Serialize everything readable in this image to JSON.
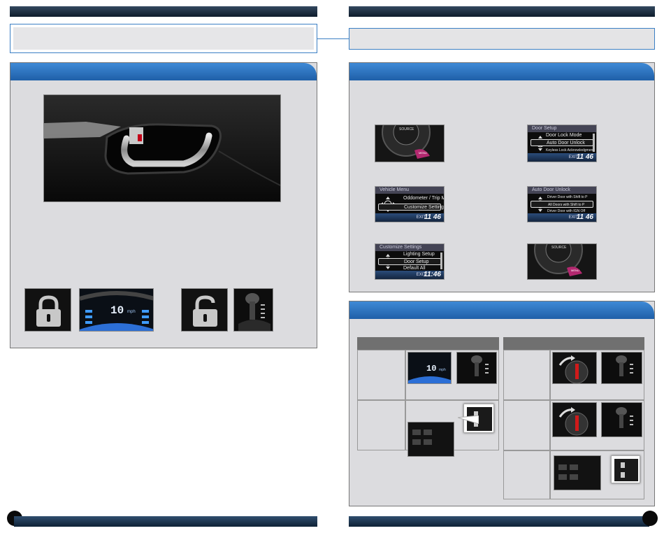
{
  "screens": {
    "vehicle_menu": {
      "header": "Vehicle Menu",
      "items": [
        "Oddometer / Trip Meter",
        "Customize Settings"
      ],
      "exit": "EXIT",
      "clock": "11 46"
    },
    "customize_settings": {
      "header": "Customize Settings",
      "items": [
        "Lighting Setup",
        "Door Setup",
        "Default All"
      ],
      "exit": "EXIT",
      "clock": "11:46"
    },
    "door_setup": {
      "header": "Door Setup",
      "items": [
        "Door Lock Mode",
        "Auto Door Unlock",
        "Keyless Lock Acknowledgment"
      ],
      "exit": "EXIT",
      "clock": "11 46"
    },
    "auto_door_unlock": {
      "header": "Auto Door Unlock",
      "items": [
        "Driver Door with Shift to P",
        "All Doors with Shift to P",
        "Driver Door with IGN Off"
      ],
      "exit": "EXIT",
      "clock": "11 46"
    }
  },
  "dial_label": "SOURCE",
  "menu_button_label": "MENU",
  "speedometer": {
    "value": "10",
    "unit": "mph"
  },
  "colors": {
    "accent_blue": "#2f74c0",
    "section_gray": "#dcdcdf",
    "table_header": "#707070"
  },
  "icons": [
    "lock-closed-icon",
    "lock-open-icon",
    "gear-shifter-icon",
    "door-handle-icon"
  ]
}
